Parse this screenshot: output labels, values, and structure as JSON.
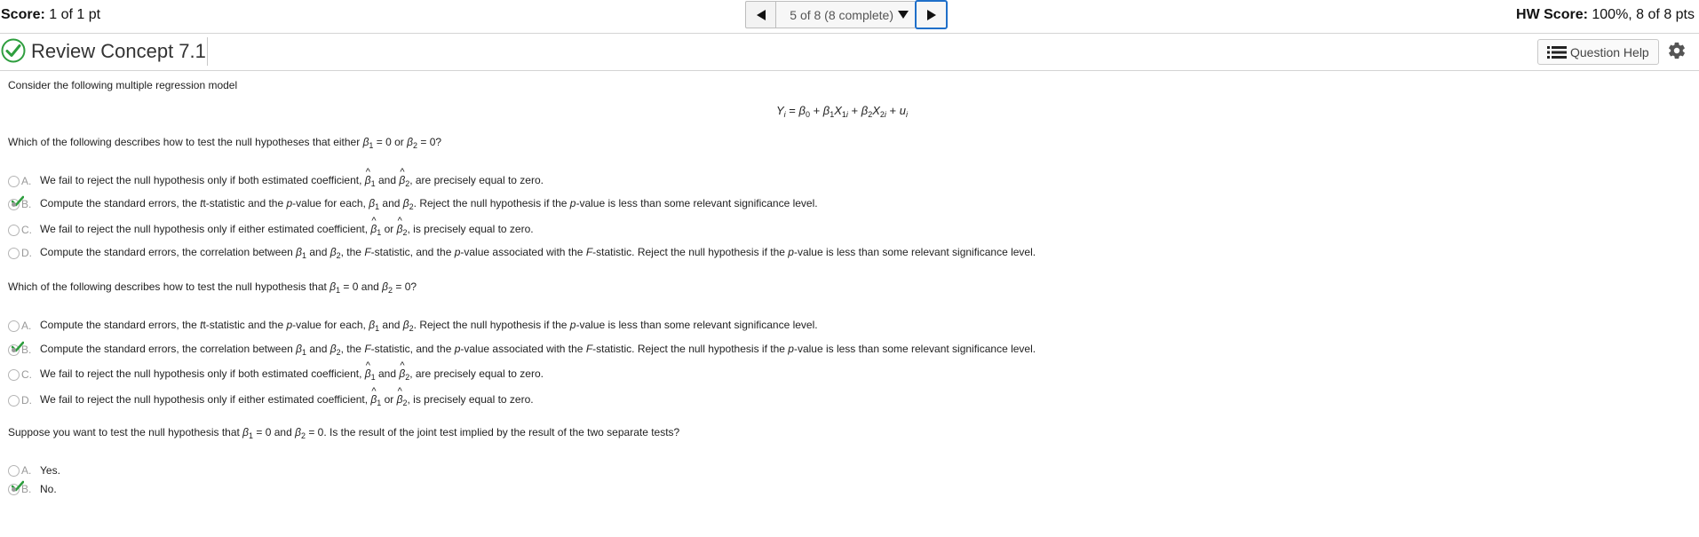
{
  "header": {
    "score_label": "Score:",
    "score_value": " 1 of 1 pt",
    "hw_label": "HW Score:",
    "hw_value": " 100%, 8 of 8 pts",
    "nav_position": "5 of 8 (8 complete)"
  },
  "title": "Review Concept 7.1",
  "question_help": "Question Help",
  "intro": "Consider the following multiple regression model",
  "questions": [
    {
      "prompt_start": "Which of the following describes how to test the null hypotheses that either ",
      "options": [
        {
          "letter": "A.",
          "selected": false
        },
        {
          "letter": "B.",
          "selected": true
        },
        {
          "letter": "C.",
          "selected": false
        },
        {
          "letter": "D.",
          "selected": false
        }
      ]
    },
    {
      "prompt_start": "Which of the following describes how to test the null hypothesis that ",
      "options": [
        {
          "letter": "A.",
          "selected": false
        },
        {
          "letter": "B.",
          "selected": true
        },
        {
          "letter": "C.",
          "selected": false
        },
        {
          "letter": "D.",
          "selected": false
        }
      ]
    },
    {
      "prompt_start": "Suppose you want to test the null hypothesis that ",
      "prompt_end": ". Is the result of the joint test implied by the result of the two separate tests?",
      "options": [
        {
          "letter": "A.",
          "text": "Yes.",
          "selected": false
        },
        {
          "letter": "B.",
          "text": "No.",
          "selected": true
        }
      ]
    }
  ],
  "text_fragments": {
    "fail_both": "We fail to reject the null hypothesis only if both estimated coefficient, ",
    "fail_either": "We fail to reject the null hypothesis only if either estimated coefficient, ",
    "are_zero": ", are precisely equal to zero.",
    "is_zero": ", is precisely equal to zero.",
    "compute_t": "Compute the standard errors, the ",
    "t_stat": "t-statistic and the ",
    "p_value_for_each": "-value for each, ",
    "reject_if": ". Reject the null hypothesis if the ",
    "less_than": "-value is less than some relevant significance level.",
    "compute_corr": "Compute the standard errors, the correlation between ",
    "the_f": ", the ",
    "f_stat_and": "-statistic, and the ",
    "assoc_f": "-value associated with the ",
    "f_stat_reject": "-statistic. Reject the null hypothesis if the ",
    "and": " and ",
    "or": " or "
  },
  "colors": {
    "accent_blue": "#1f6fc9",
    "check_green": "#2e9e3e"
  }
}
